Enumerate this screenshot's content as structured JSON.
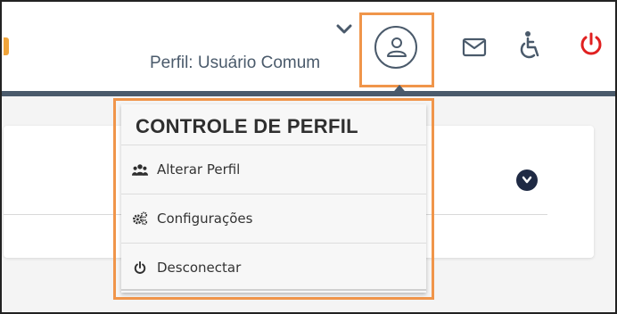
{
  "header": {
    "profile_label": "Perfil: Usuário Comum",
    "colors": {
      "accent": "#f0954a",
      "power": "#e02020",
      "bar": "#4a5a6b"
    },
    "icons": [
      "chevron-down-icon",
      "user-icon",
      "mail-icon",
      "accessibility-icon",
      "power-icon"
    ]
  },
  "dropdown": {
    "title": "CONTROLE DE PERFIL",
    "items": [
      {
        "label": "Alterar Perfil",
        "icon": "users-icon"
      },
      {
        "label": "Configurações",
        "icon": "gears-icon"
      },
      {
        "label": "Desconectar",
        "icon": "power-icon"
      }
    ]
  },
  "card": {
    "expand_icon": "chevron-circle-down-icon"
  }
}
